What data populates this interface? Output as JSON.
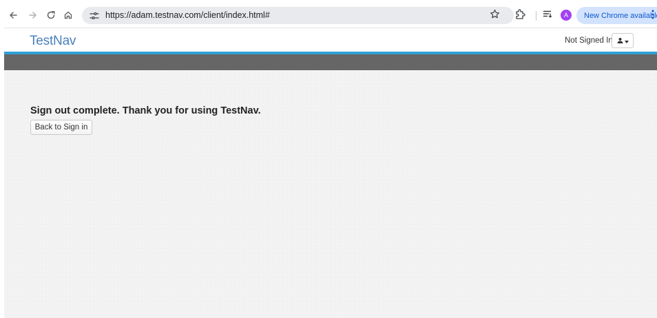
{
  "browser": {
    "url": "https://adam.testnav.com/client/index.html#",
    "profile_initial": "A",
    "update_label": "New Chrome available",
    "icons": [
      "back-arrow-icon",
      "forward-arrow-icon",
      "reload-icon",
      "home-icon",
      "site-info-icon",
      "bookmark-star-icon",
      "extensions-icon",
      "reading-list-icon",
      "more-vert-icon"
    ],
    "colors": {
      "omnibox": "#e8eaed",
      "update_chip": "#d3e3fd",
      "update_text": "#0b57d0",
      "avatar": "#a142f4"
    }
  },
  "header": {
    "brand": "TestNav",
    "signin_status": "Not Signed In",
    "user_menu_icons": [
      "user-icon",
      "caret-down-icon"
    ],
    "colors": {
      "brand": "#4a80b9",
      "stripe": "#2fa0d6",
      "bar": "#666666"
    }
  },
  "main": {
    "message": "Sign out complete. Thank you for using TestNav.",
    "back_button_label": "Back to Sign in"
  }
}
